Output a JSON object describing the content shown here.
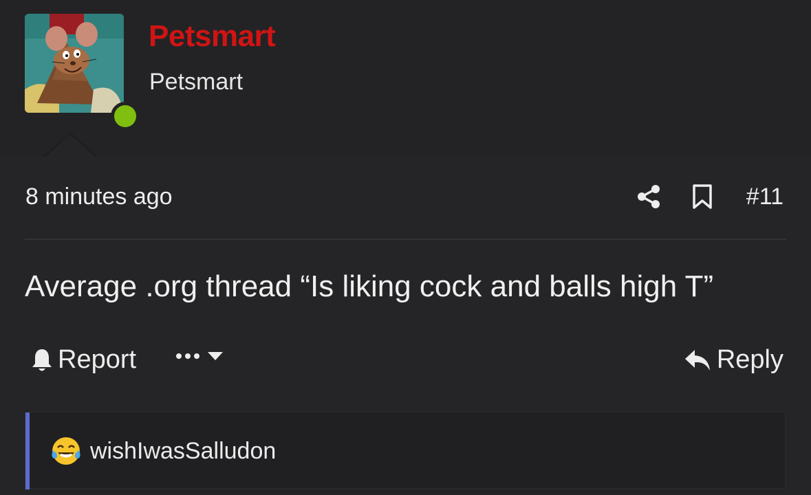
{
  "user": {
    "username": "Petsmart",
    "title": "Petsmart",
    "online": true,
    "username_color": "#d01414",
    "online_color": "#7fbf0f"
  },
  "post": {
    "time": "8 minutes ago",
    "number": "#11",
    "content": "Average .org thread “Is liking cock and balls high T”",
    "share_icon": "share-icon",
    "bookmark_icon": "bookmark-icon"
  },
  "footer": {
    "report_label": "Report",
    "reply_label": "Reply",
    "more_icon": "ellipsis-icon"
  },
  "reactions": {
    "emoji": "tears-of-joy",
    "users": "wishIwasSalludon",
    "accent_color": "#5b6cc9"
  }
}
